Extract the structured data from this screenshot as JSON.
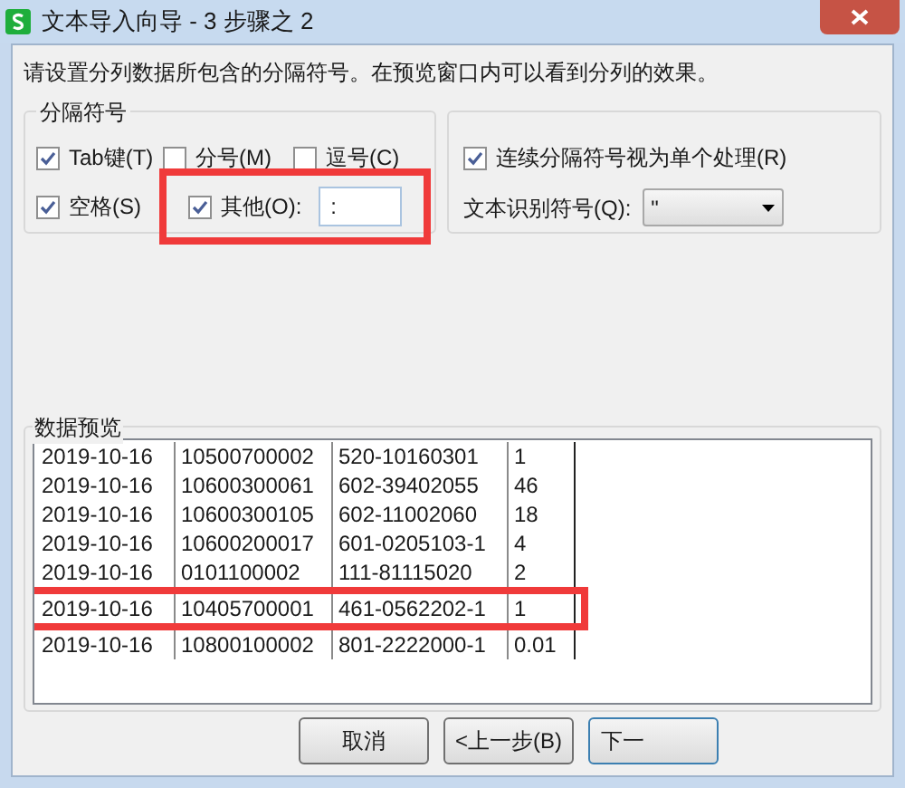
{
  "window": {
    "title": "文本导入向导 - 3 步骤之 2"
  },
  "instruction": "请设置分列数据所包含的分隔符号。在预览窗口内可以看到分列的效果。",
  "delimiters": {
    "title": "分隔符号",
    "options": [
      {
        "label": "Tab键(T)",
        "checked": true
      },
      {
        "label": "分号(M)",
        "checked": false
      },
      {
        "label": "逗号(C)",
        "checked": false
      },
      {
        "label": "空格(S)",
        "checked": true
      },
      {
        "label": "其他(O):",
        "checked": true,
        "highlighted": true,
        "value": ":"
      }
    ]
  },
  "treat_consecutive": {
    "label": "连续分隔符号视为单个处理(R)",
    "checked": true
  },
  "text_qualifier": {
    "label": "文本识别符号(Q):",
    "value": "\""
  },
  "preview": {
    "title": "数据预览",
    "rows": [
      {
        "highlighted": false,
        "cells": [
          "2019-10-16",
          "10500700002",
          "520-10160301",
          "1"
        ]
      },
      {
        "highlighted": false,
        "cells": [
          "2019-10-16",
          "10600300061",
          "602-39402055",
          "46"
        ]
      },
      {
        "highlighted": false,
        "cells": [
          "2019-10-16",
          "10600300105",
          "602-11002060",
          "18"
        ]
      },
      {
        "highlighted": false,
        "cells": [
          "2019-10-16",
          "10600200017",
          "601-0205103-1",
          "4"
        ]
      },
      {
        "highlighted": false,
        "cells": [
          "2019-10-16",
          "0101100002",
          "111-81115020",
          "2"
        ]
      },
      {
        "highlighted": true,
        "cells": [
          "2019-10-16",
          "10405700001",
          "461-0562202-1",
          "1"
        ]
      },
      {
        "highlighted": false,
        "cells": [
          "2019-10-16",
          "10800100002",
          "801-2222000-1",
          "0.01"
        ]
      }
    ]
  },
  "buttons": [
    "取消",
    "<上一步(B)",
    "下一"
  ]
}
